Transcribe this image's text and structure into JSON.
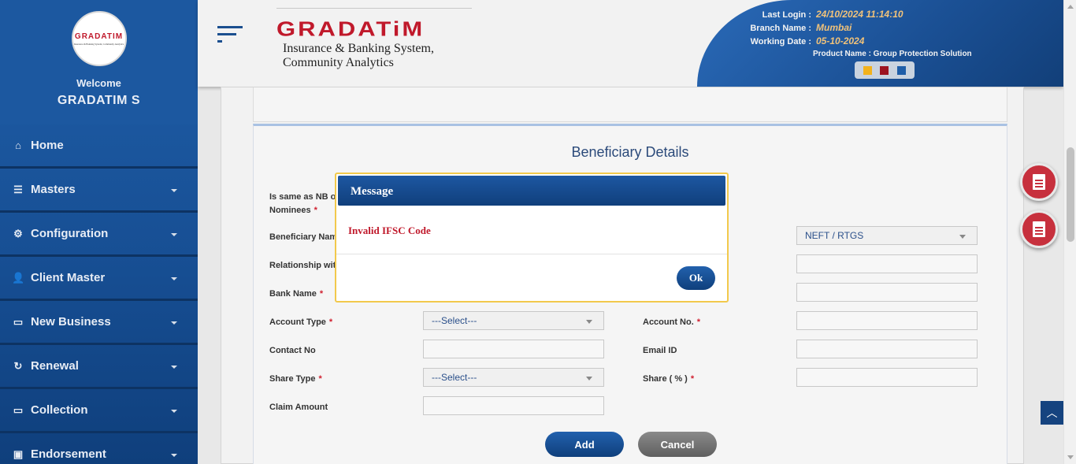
{
  "sidebar": {
    "logo_text": "GRADATIM",
    "logo_subtext": "Insurance & Banking System, Community Analytics",
    "welcome": "Welcome",
    "user_name": "GRADATIM S",
    "items": [
      {
        "label": "Home",
        "icon": "home-icon",
        "glyph": "⌂"
      },
      {
        "label": "Masters",
        "icon": "database-icon",
        "glyph": "☰"
      },
      {
        "label": "Configuration",
        "icon": "gears-icon",
        "glyph": "⚙"
      },
      {
        "label": "Client Master",
        "icon": "user-icon",
        "glyph": "👤"
      },
      {
        "label": "New Business",
        "icon": "monitor-icon",
        "glyph": "▭"
      },
      {
        "label": "Renewal",
        "icon": "refresh-icon",
        "glyph": "↻"
      },
      {
        "label": "Collection",
        "icon": "monitor-icon",
        "glyph": "▭"
      },
      {
        "label": "Endorsement",
        "icon": "briefcase-icon",
        "glyph": "▣"
      }
    ]
  },
  "header": {
    "brand_title": "GRADATiM",
    "brand_subtitle": "Insurance & Banking System, Community Analytics",
    "last_login_label": "Last Login :",
    "last_login_value": "24/10/2024 11:14:10",
    "branch_label": "Branch Name :",
    "branch_value": "Mumbai",
    "working_date_label": "Working Date :",
    "working_date_value": "05-10-2024",
    "product_label": "Product Name : Group Protection Solution",
    "theme_colors": [
      "#f2b21c",
      "#9c1320",
      "#1f5ea8"
    ]
  },
  "form": {
    "title": "Beneficiary Details",
    "same_as_label": "Is same as NB o",
    "nominees_label": "Nominees",
    "beneficiary_name_label": "Beneficiary Nam",
    "relationship_label": "Relationship wit",
    "bank_name_label": "Bank Name",
    "account_type_label": "Account Type",
    "account_type_value": "---Select---",
    "account_no_label": "Account No.",
    "contact_label": "Contact No",
    "email_label": "Email ID",
    "share_type_label": "Share Type",
    "share_type_value": "---Select---",
    "share_pct_label": "Share ( % )",
    "claim_amount_label": "Claim Amount",
    "payment_mode_value": "NEFT / RTGS",
    "required_mark": "*",
    "add_label": "Add",
    "cancel_label": "Cancel"
  },
  "modal": {
    "title": "Message",
    "message": "Invalid IFSC Code",
    "ok_label": "Ok"
  },
  "colors": {
    "accent": "#1a4f93",
    "error": "#c0192b",
    "brand_red": "#c7303d"
  }
}
